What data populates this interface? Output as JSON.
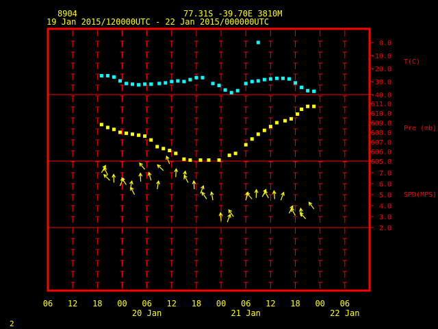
{
  "header": {
    "station_id": "8904",
    "location": "77.31S   -39.70E   3810M",
    "period": "19 Jan 2015/120000UTC - 22 Jan 2015/000000UTC"
  },
  "footer": {
    "page_number": "2"
  },
  "colors": {
    "background": "#000000",
    "frame": "#ff0000",
    "axis_text": "#ffff00",
    "temperature": "#00ffff",
    "pressure": "#ffff00",
    "wind": "#ffff00"
  },
  "chart_data": {
    "type": "scatter",
    "x_axis": {
      "unit": "hours since 19 Jan 2015 06 UTC",
      "range": [
        0,
        78
      ],
      "tick_hours": [
        0,
        6,
        12,
        18,
        24,
        30,
        36,
        42,
        48,
        54,
        60,
        66,
        72,
        78
      ],
      "tick_labels": [
        "06",
        "12",
        "18",
        "00",
        "06",
        "12",
        "18",
        "00",
        "06",
        "12",
        "18",
        "00",
        "06"
      ],
      "day_labels": [
        {
          "hour": 24,
          "label": "20 Jan"
        },
        {
          "hour": 48,
          "label": "21 Jan"
        },
        {
          "hour": 72,
          "label": "22 Jan"
        }
      ]
    },
    "temperature": {
      "label": "T(C)",
      "ticks": [
        0.0,
        -10.0,
        -20.0,
        -30.0,
        -40.0
      ],
      "tick_labels": [
        "0.0",
        "-10.0",
        "-20.0",
        "-30.0",
        "-40.0"
      ],
      "range": [
        -40,
        0
      ],
      "points": [
        [
          13,
          -25.5
        ],
        [
          14.5,
          -25.5
        ],
        [
          16,
          -26.5
        ],
        [
          17.5,
          -29.5
        ],
        [
          19,
          -31.5
        ],
        [
          20.5,
          -32
        ],
        [
          22,
          -32.5
        ],
        [
          23.5,
          -32
        ],
        [
          25,
          -32
        ],
        [
          27,
          -31.5
        ],
        [
          28.5,
          -31
        ],
        [
          30,
          -30
        ],
        [
          31.5,
          -29.5
        ],
        [
          33,
          -30
        ],
        [
          34.5,
          -28.5
        ],
        [
          36,
          -27
        ],
        [
          37.5,
          -27
        ],
        [
          40,
          -31.5
        ],
        [
          41.5,
          -33
        ],
        [
          43,
          -36.5
        ],
        [
          44.5,
          -38.5
        ],
        [
          46,
          -37
        ],
        [
          48,
          -31.5
        ],
        [
          49.5,
          -30
        ],
        [
          51,
          -29.5
        ],
        [
          52.5,
          -28.5
        ],
        [
          54,
          -28
        ],
        [
          55.5,
          -27.5
        ],
        [
          57,
          -27.5
        ],
        [
          58.5,
          -28
        ],
        [
          60,
          -31
        ],
        [
          61.5,
          -34.5
        ],
        [
          63,
          -37
        ],
        [
          64.5,
          -37.5
        ],
        [
          51,
          0
        ]
      ]
    },
    "pressure": {
      "label": "Pre (mb)",
      "ticks": [
        605.0,
        606.0,
        607.0,
        608.0,
        609.0,
        610.0,
        611.0
      ],
      "tick_labels": [
        "605.0",
        "606.0",
        "607.0",
        "608.0",
        "609.0",
        "610.0",
        "611.0"
      ],
      "range": [
        605,
        611
      ],
      "points": [
        [
          13,
          608.8
        ],
        [
          14.5,
          608.5
        ],
        [
          16,
          608.3
        ],
        [
          17.5,
          608.0
        ],
        [
          19,
          607.9
        ],
        [
          20.5,
          607.8
        ],
        [
          22,
          607.7
        ],
        [
          23.5,
          607.6
        ],
        [
          25,
          607.2
        ],
        [
          26.5,
          606.5
        ],
        [
          28,
          606.3
        ],
        [
          29.5,
          606.1
        ],
        [
          31,
          605.8
        ],
        [
          33,
          605.2
        ],
        [
          34.5,
          605.1
        ],
        [
          37,
          605.1
        ],
        [
          39,
          605.1
        ],
        [
          41.5,
          605.1
        ],
        [
          44,
          605.6
        ],
        [
          45.5,
          605.8
        ],
        [
          48,
          606.7
        ],
        [
          49.5,
          607.3
        ],
        [
          51,
          607.8
        ],
        [
          52.5,
          608.2
        ],
        [
          54,
          608.6
        ],
        [
          55.5,
          609.0
        ],
        [
          57.5,
          609.2
        ],
        [
          59,
          609.4
        ],
        [
          60.5,
          609.9
        ],
        [
          61.5,
          610.4
        ],
        [
          63,
          610.7
        ],
        [
          64.5,
          610.7
        ]
      ]
    },
    "wind_speed": {
      "label": "SPD(MPS)",
      "ticks": [
        2.0,
        3.0,
        4.0,
        5.0,
        6.0,
        7.0
      ],
      "tick_labels": [
        "2.0",
        "3.0",
        "4.0",
        "5.0",
        "6.0",
        "7.0"
      ],
      "range": [
        1.5,
        7.7
      ],
      "points": [
        [
          13,
          7.0
        ],
        [
          14.5,
          6.8
        ],
        [
          15,
          6.3
        ],
        [
          16,
          6.1
        ],
        [
          17.5,
          5.8
        ],
        [
          19,
          5.9
        ],
        [
          20,
          5.5
        ],
        [
          21,
          5.0
        ],
        [
          22.5,
          6.2
        ],
        [
          23.5,
          7.3
        ],
        [
          25,
          6.3
        ],
        [
          26.5,
          5.5
        ],
        [
          28,
          7.2
        ],
        [
          29.5,
          7.8
        ],
        [
          31,
          6.6
        ],
        [
          33,
          6.4
        ],
        [
          34,
          6.1
        ],
        [
          35.5,
          5.5
        ],
        [
          37,
          5.1
        ],
        [
          38.5,
          4.6
        ],
        [
          40,
          4.5
        ],
        [
          42,
          2.6
        ],
        [
          43.5,
          2.5
        ],
        [
          45,
          3.0
        ],
        [
          48,
          4.5
        ],
        [
          49.5,
          4.6
        ],
        [
          50.5,
          4.7
        ],
        [
          52,
          4.8
        ],
        [
          53.5,
          4.7
        ],
        [
          55,
          4.6
        ],
        [
          56.5,
          4.5
        ],
        [
          58.5,
          3.3
        ],
        [
          60,
          3.1
        ],
        [
          61.5,
          3.0
        ],
        [
          62.5,
          2.8
        ],
        [
          64.5,
          3.7
        ]
      ]
    }
  }
}
